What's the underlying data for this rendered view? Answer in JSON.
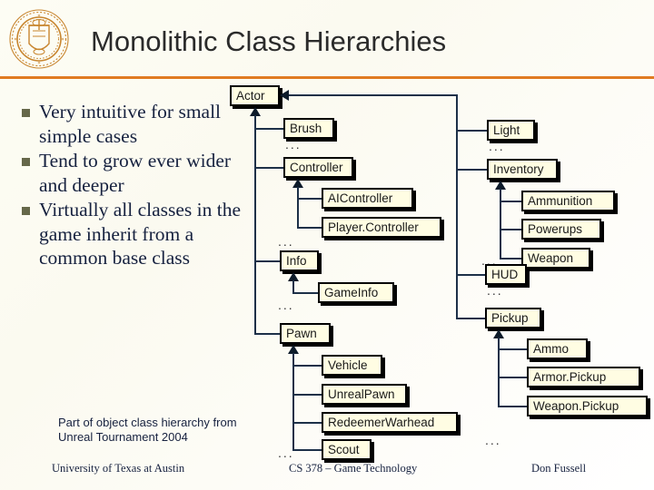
{
  "slide": {
    "title": "Monolithic Class Hierarchies",
    "logo_icon": "ut-austin-seal-logo",
    "accent_color": "#e07b22",
    "node_fill": "#fffde3",
    "bullet_color": "#66684a",
    "line_color": "#1d3048"
  },
  "bullets": [
    {
      "text": "Very intuitive for small simple cases"
    },
    {
      "text": "Tend to grow ever wider and deeper"
    },
    {
      "text": "Virtually all classes in the game inherit from a common base class"
    }
  ],
  "caption": "Part of object class hierarchy from Unreal Tournament 2004",
  "footer": {
    "left": "University of Texas at Austin",
    "center": "CS 378 – Game Technology",
    "right": "Don Fussell"
  },
  "diagram": {
    "root": "Actor",
    "ellipsis": "...",
    "left_column": [
      {
        "label": "Brush"
      },
      {
        "label": "Controller"
      },
      {
        "label": "AIController"
      },
      {
        "label": "Player.Controller"
      },
      {
        "label": "Info"
      },
      {
        "label": "GameInfo"
      },
      {
        "label": "Pawn"
      },
      {
        "label": "Vehicle"
      },
      {
        "label": "UnrealPawn"
      },
      {
        "label": "RedeemerWarhead"
      },
      {
        "label": "Scout"
      }
    ],
    "right_column": [
      {
        "label": "Light"
      },
      {
        "label": "Inventory"
      },
      {
        "label": "Ammunition"
      },
      {
        "label": "Powerups"
      },
      {
        "label": "Weapon"
      },
      {
        "label": "HUD"
      },
      {
        "label": "Pickup"
      },
      {
        "label": "Ammo"
      },
      {
        "label": "Armor.Pickup"
      },
      {
        "label": "Weapon.Pickup"
      }
    ]
  }
}
